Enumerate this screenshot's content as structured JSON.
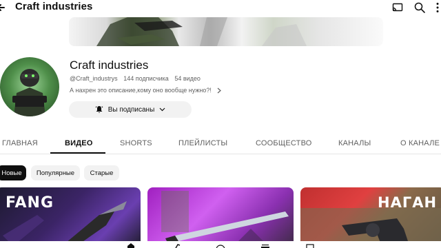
{
  "header": {
    "title": "Craft industries"
  },
  "channel": {
    "name": "Craft industries",
    "handle": "@Craft_industrys",
    "subscribers": "144 подписчика",
    "videos": "54 видео",
    "description": "А нахрен это описание,кому оно вообще нужно?!",
    "subscribe_label": "Вы подписаны"
  },
  "tabs": [
    {
      "label": "ГЛАВНАЯ"
    },
    {
      "label": "ВИДЕО"
    },
    {
      "label": "SHORTS"
    },
    {
      "label": "ПЛЕЙЛИСТЫ"
    },
    {
      "label": "СООБЩЕСТВО"
    },
    {
      "label": "КАНАЛЫ"
    },
    {
      "label": "О КАНАЛЕ"
    }
  ],
  "active_tab": "ВИДЕО",
  "filters": [
    {
      "label": "Новые"
    },
    {
      "label": "Популярные"
    },
    {
      "label": "Старые"
    }
  ],
  "active_filter": "Новые",
  "videos": [
    {
      "thumb_text": "FANG",
      "accent": "#5a2a8a"
    },
    {
      "thumb_text": "",
      "accent": "#c040e0"
    },
    {
      "thumb_text": "НАГАН",
      "accent": "#d82a2a"
    }
  ],
  "icons": {
    "back": "arrow-left-icon",
    "cast": "cast-icon",
    "search": "search-icon",
    "more": "more-vert-icon",
    "bell": "bell-icon",
    "chevron": "chevron-down-icon"
  }
}
